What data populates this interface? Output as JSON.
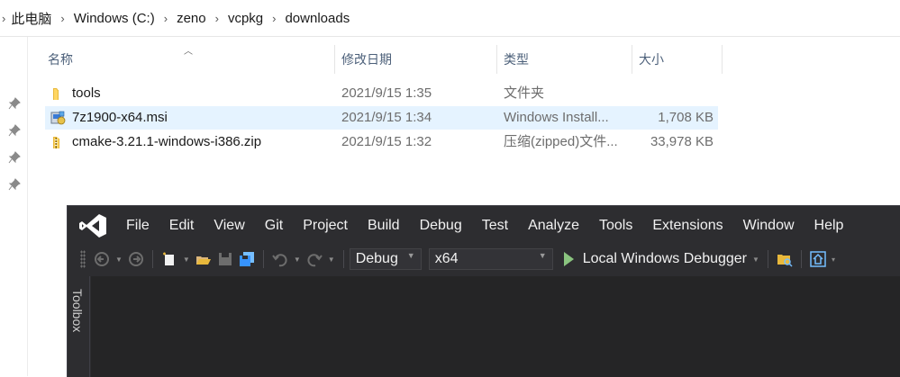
{
  "explorer": {
    "breadcrumb": [
      "此电脑",
      "Windows (C:)",
      "zeno",
      "vcpkg",
      "downloads"
    ],
    "columns": {
      "name": "名称",
      "date": "修改日期",
      "type": "类型",
      "size": "大小"
    },
    "files": [
      {
        "name": "tools",
        "date": "2021/9/15 1:35",
        "type": "文件夹",
        "size": "",
        "icon": "folder-icon"
      },
      {
        "name": "7z1900-x64.msi",
        "date": "2021/9/15 1:34",
        "type": "Windows Install...",
        "size": "1,708 KB",
        "icon": "msi-installer-icon"
      },
      {
        "name": "cmake-3.21.1-windows-i386.zip",
        "date": "2021/9/15 1:32",
        "type": "压缩(zipped)文件...",
        "size": "33,978 KB",
        "icon": "zip-folder-icon"
      }
    ],
    "selected_row_color": "#e5f3ff"
  },
  "vs": {
    "menu": [
      "File",
      "Edit",
      "View",
      "Git",
      "Project",
      "Build",
      "Debug",
      "Test",
      "Analyze",
      "Tools",
      "Extensions",
      "Window",
      "Help"
    ],
    "config": "Debug",
    "platform": "x64",
    "run_label": "Local Windows Debugger",
    "toolbox_label": "Toolbox",
    "accent": "#8661c5",
    "background": "#2d2d30"
  }
}
